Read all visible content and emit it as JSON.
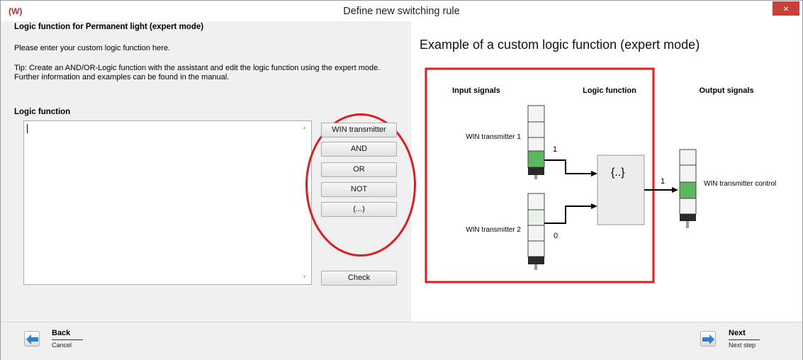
{
  "window": {
    "title": "Define new switching rule",
    "close_icon": "×",
    "logo_text": "(W)"
  },
  "left": {
    "heading": "Logic function for Permanent light (expert mode)",
    "instruction": "Please enter your custom logic function here.",
    "tip": "Tip: Create an AND/OR-Logic function with the assistant and edit the logic function using the expert mode. Further information and examples can be found in the manual.",
    "logic_function_label": "Logic function",
    "logic_function_value": "",
    "buttons": [
      "WIN transmitter",
      "AND",
      "OR",
      "NOT",
      "(...)"
    ],
    "check_label": "Check"
  },
  "example": {
    "title": "Example of a custom logic function (expert mode)",
    "input_signals": "Input signals",
    "logic_function": "Logic function",
    "output_signals": "Output signals",
    "transmitter1": "WIN transmitter 1",
    "transmitter2": "WIN transmitter 2",
    "output_label": "WIN transmitter control",
    "signal1": "1",
    "signal2": "0",
    "output_signal": "1",
    "function_symbol": "{..}"
  },
  "footer": {
    "back_label": "Back",
    "back_sub": "Cancel",
    "next_label": "Next",
    "next_sub": "Next step"
  },
  "colors": {
    "highlight_red": "#e11b22",
    "light_green": "#5cb85c",
    "arrow_blue": "#2f7fd1",
    "close_red": "#c7403a"
  }
}
